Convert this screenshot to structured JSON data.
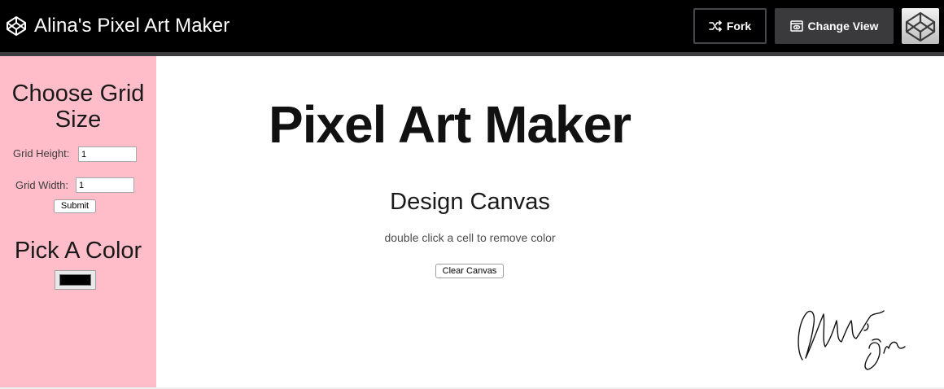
{
  "header": {
    "app_title": "Alina's Pixel Art Maker",
    "fork_label": "Fork",
    "change_view_label": "Change View"
  },
  "sidebar": {
    "grid_heading": "Choose Grid Size",
    "height_label": "Grid Height:",
    "height_value": "1",
    "width_label": "Grid Width:",
    "width_value": "1",
    "submit_label": "Submit",
    "color_heading": "Pick A Color",
    "selected_color": "#000000"
  },
  "main": {
    "title": "Pixel Art Maker",
    "canvas_heading": "Design Canvas",
    "canvas_hint": "double click a cell to remove color",
    "clear_label": "Clear Canvas"
  },
  "signature": {
    "text": "Alina Din"
  },
  "colors": {
    "header_bg": "#000000",
    "sidebar_bg": "#ffbdc9",
    "page_bg": "#ffffff"
  },
  "icons": {
    "brand": "codepen-logo-icon",
    "fork": "fork-icon",
    "change_view": "change-view-icon",
    "avatar": "user-avatar-icon"
  }
}
